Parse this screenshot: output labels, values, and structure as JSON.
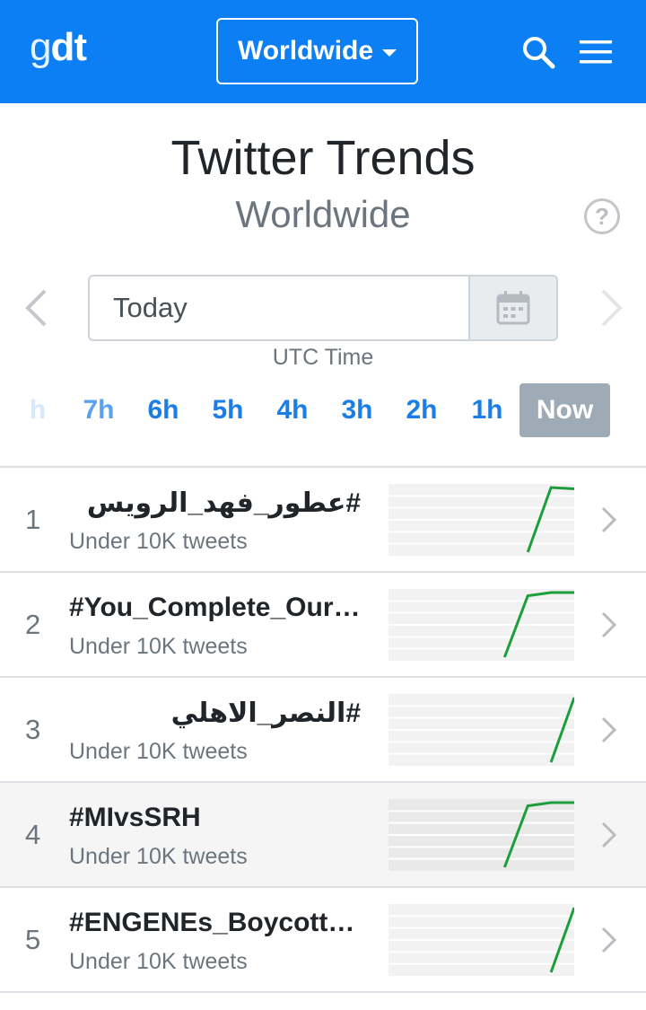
{
  "header": {
    "logo_g": "g",
    "logo_dt": "dt",
    "location_button": "Worldwide"
  },
  "page": {
    "title": "Twitter Trends",
    "subtitle": "Worldwide",
    "help": "?"
  },
  "date_picker": {
    "value": "Today",
    "utc_label": "UTC Time"
  },
  "hours": [
    "h",
    "7h",
    "6h",
    "5h",
    "4h",
    "3h",
    "2h",
    "1h",
    "Now"
  ],
  "trends": [
    {
      "rank": "1",
      "name": "#عطور_فهد_الرويس",
      "count": "Under 10K tweets",
      "spark": [
        null,
        null,
        null,
        null,
        null,
        null,
        0.0,
        1.0,
        0.98
      ],
      "selected": false
    },
    {
      "rank": "2",
      "name": "#You_Complete_Our…",
      "count": "Under 10K tweets",
      "spark": [
        null,
        null,
        null,
        null,
        null,
        0.0,
        0.95,
        1.0,
        1.0
      ],
      "selected": false
    },
    {
      "rank": "3",
      "name": "#النصر_الاهلي",
      "count": "Under 10K tweets",
      "spark": [
        null,
        null,
        null,
        null,
        null,
        null,
        null,
        0.0,
        1.0
      ],
      "selected": false
    },
    {
      "rank": "4",
      "name": "#MIvsSRH",
      "count": "Under 10K tweets",
      "spark": [
        null,
        null,
        null,
        null,
        null,
        0.0,
        0.95,
        1.0,
        1.0
      ],
      "selected": true
    },
    {
      "rank": "5",
      "name": "#ENGENEs_Boycott_…",
      "count": "Under 10K tweets",
      "spark": [
        null,
        null,
        null,
        null,
        null,
        null,
        null,
        0.0,
        1.0
      ],
      "selected": false
    }
  ],
  "colors": {
    "header_bg": "#0d7ff5",
    "accent": "#1a7de8",
    "spark_line": "#1e9e3a",
    "now_bg": "#9eaab6"
  }
}
